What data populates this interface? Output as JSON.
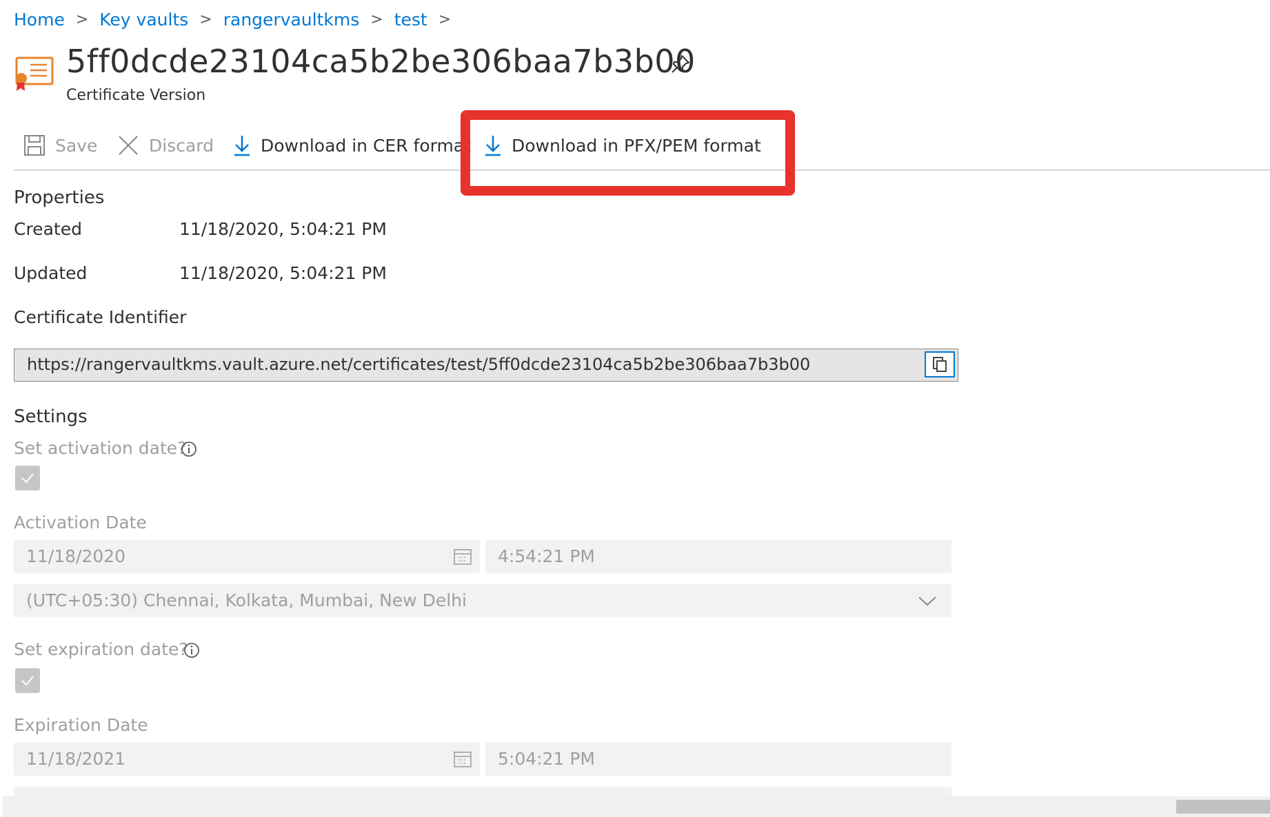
{
  "breadcrumb": [
    "Home",
    "Key vaults",
    "rangervaultkms",
    "test"
  ],
  "header": {
    "title": "5ff0dcde23104ca5b2be306baa7b3b00",
    "subtitle": "Certificate Version"
  },
  "toolbar": {
    "save_label": "Save",
    "discard_label": "Discard",
    "download_cer_label": "Download in CER format",
    "download_pfx_label": "Download in PFX/PEM format"
  },
  "properties": {
    "heading": "Properties",
    "created_label": "Created",
    "created_value": "11/18/2020, 5:04:21 PM",
    "updated_label": "Updated",
    "updated_value": "11/18/2020, 5:04:21 PM",
    "identifier_label": "Certificate Identifier",
    "identifier_value": "https://rangervaultkms.vault.azure.net/certificates/test/5ff0dcde23104ca5b2be306baa7b3b00"
  },
  "settings": {
    "heading": "Settings",
    "set_activation_label": "Set activation date?",
    "activation_checked": true,
    "activation_date_label": "Activation Date",
    "activation_date": "11/18/2020",
    "activation_time": "4:54:21 PM",
    "timezone": "(UTC+05:30) Chennai, Kolkata, Mumbai, New Delhi",
    "set_expiration_label": "Set expiration date?",
    "expiration_checked": true,
    "expiration_date_label": "Expiration Date",
    "expiration_date": "11/18/2021",
    "expiration_time": "5:04:21 PM"
  },
  "colors": {
    "accent": "#0078d4",
    "highlight": "#e8322c",
    "disabled_text": "#a19f9d"
  }
}
